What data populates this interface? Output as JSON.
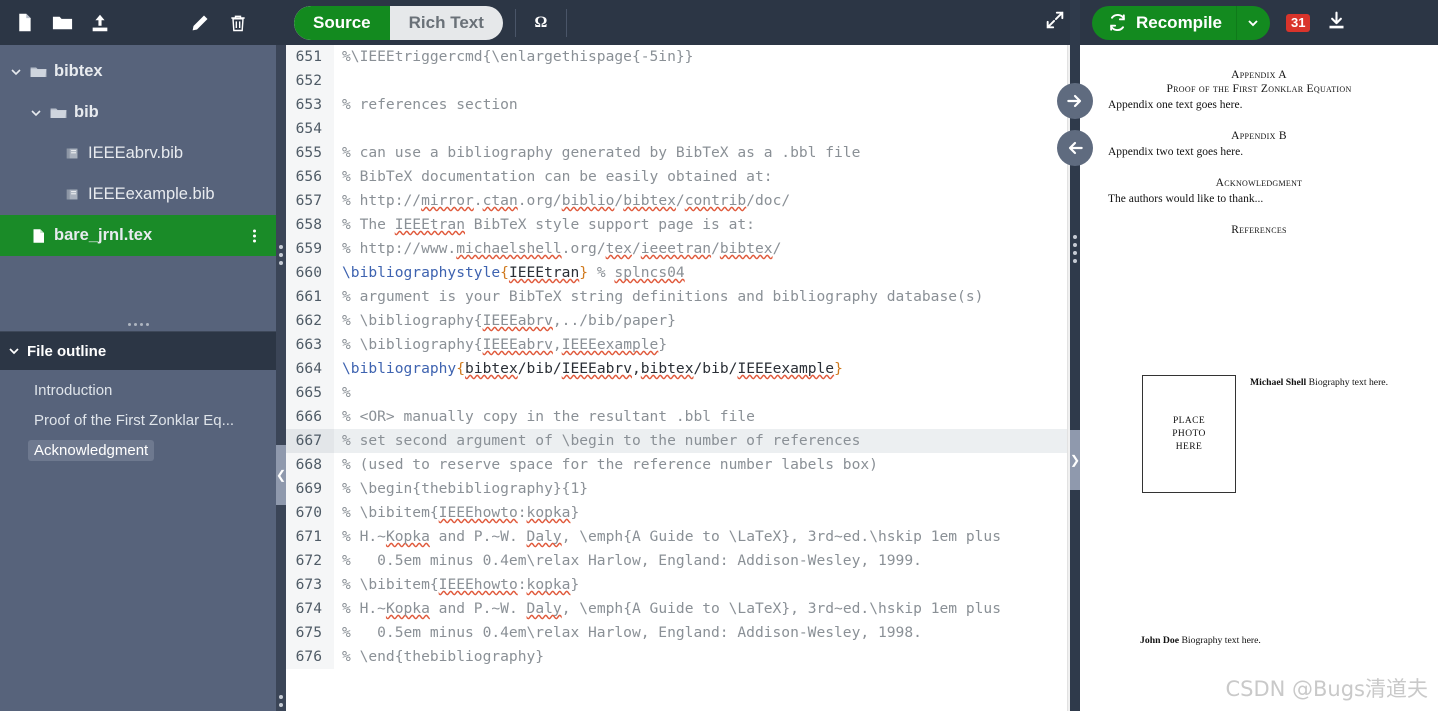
{
  "file_toolbar": {
    "icons": [
      {
        "name": "new-file-icon",
        "label": "New file"
      },
      {
        "name": "new-folder-icon",
        "label": "New folder"
      },
      {
        "name": "upload-icon",
        "label": "Upload"
      },
      {
        "name": "rename-pencil-icon",
        "label": "Rename"
      },
      {
        "name": "delete-trash-icon",
        "label": "Delete"
      }
    ]
  },
  "file_tree": {
    "items": [
      {
        "label": "bibtex",
        "type": "folder",
        "depth": 0,
        "expanded": true,
        "selected": false
      },
      {
        "label": "bib",
        "type": "folder",
        "depth": 1,
        "expanded": true,
        "selected": false
      },
      {
        "label": "IEEEabrv.bib",
        "type": "bib",
        "depth": 2,
        "selected": false
      },
      {
        "label": "IEEEexample.bib",
        "type": "bib",
        "depth": 2,
        "selected": false
      },
      {
        "label": "bare_jrnl.tex",
        "type": "tex",
        "depth": 0,
        "selected": true
      }
    ]
  },
  "outline": {
    "title": "File outline",
    "expanded": true,
    "items": [
      {
        "label": "Introduction",
        "active": false
      },
      {
        "label": "Proof of the First Zonklar Eq...",
        "active": false
      },
      {
        "label": "Acknowledgment",
        "active": true
      }
    ]
  },
  "editor_toolbar": {
    "mode_source": "Source",
    "mode_rich_text": "Rich Text",
    "symbol_button": "Ω",
    "expand_label": "Expand editor"
  },
  "pdf_toolbar": {
    "recompile_label": "Recompile",
    "log_badge_count": "31",
    "download_label": "Download PDF"
  },
  "colors": {
    "accent_green": "#138a1f",
    "toolbar_dark": "#2c3645",
    "sidebar": "#57637b",
    "badge_red": "#d9342b",
    "spell_underline": "#e05a3c",
    "command_blue": "#3e63b0",
    "brace_orange": "#d07a1e",
    "comment_gray": "#8a9096"
  },
  "code": {
    "first_line": 651,
    "active_line": 667,
    "lines": [
      {
        "n": 651,
        "segments": [
          {
            "t": "%\\IEEEtriggercmd{\\enlargethispage{-5in}}",
            "c": "cmt"
          }
        ]
      },
      {
        "n": 652,
        "segments": [
          {
            "t": "",
            "c": "cmt"
          }
        ]
      },
      {
        "n": 653,
        "segments": [
          {
            "t": "% references section",
            "c": "cmt"
          }
        ]
      },
      {
        "n": 654,
        "segments": [
          {
            "t": "",
            "c": "cmt"
          }
        ]
      },
      {
        "n": 655,
        "segments": [
          {
            "t": "% can use a bibliography generated by BibTeX as a .bbl file",
            "c": "cmt"
          }
        ]
      },
      {
        "n": 656,
        "segments": [
          {
            "t": "% BibTeX documentation can be easily obtained at:",
            "c": "cmt"
          }
        ]
      },
      {
        "n": 657,
        "segments": [
          {
            "t": "% http://",
            "c": "cmt"
          },
          {
            "t": "mirror",
            "c": "cmt sq"
          },
          {
            "t": ".",
            "c": "cmt"
          },
          {
            "t": "ctan",
            "c": "cmt sq"
          },
          {
            "t": ".org/",
            "c": "cmt"
          },
          {
            "t": "biblio",
            "c": "cmt sq"
          },
          {
            "t": "/",
            "c": "cmt"
          },
          {
            "t": "bibtex",
            "c": "cmt sq"
          },
          {
            "t": "/",
            "c": "cmt"
          },
          {
            "t": "contrib",
            "c": "cmt sq"
          },
          {
            "t": "/doc/",
            "c": "cmt"
          }
        ]
      },
      {
        "n": 658,
        "segments": [
          {
            "t": "% The ",
            "c": "cmt"
          },
          {
            "t": "IEEEtran",
            "c": "cmt sq"
          },
          {
            "t": " BibTeX style support page is at:",
            "c": "cmt"
          }
        ]
      },
      {
        "n": 659,
        "segments": [
          {
            "t": "% http://www.",
            "c": "cmt"
          },
          {
            "t": "michaelshell",
            "c": "cmt sq"
          },
          {
            "t": ".org/",
            "c": "cmt"
          },
          {
            "t": "tex",
            "c": "cmt sq"
          },
          {
            "t": "/",
            "c": "cmt"
          },
          {
            "t": "ieeetran",
            "c": "cmt sq"
          },
          {
            "t": "/",
            "c": "cmt"
          },
          {
            "t": "bibtex",
            "c": "cmt sq"
          },
          {
            "t": "/",
            "c": "cmt"
          }
        ]
      },
      {
        "n": 660,
        "segments": [
          {
            "t": "\\bibliographystyle",
            "c": "cmd"
          },
          {
            "t": "{",
            "c": "brc"
          },
          {
            "t": "IEEEtran",
            "c": "arg sq"
          },
          {
            "t": "}",
            "c": "brc"
          },
          {
            "t": " % ",
            "c": "cmt"
          },
          {
            "t": "splncs04",
            "c": "cmt sq"
          }
        ]
      },
      {
        "n": 661,
        "segments": [
          {
            "t": "% argument is your BibTeX string definitions and bibliography database(s)",
            "c": "cmt"
          }
        ]
      },
      {
        "n": 662,
        "segments": [
          {
            "t": "% \\bibliography{",
            "c": "cmt"
          },
          {
            "t": "IEEEabrv",
            "c": "cmt sq"
          },
          {
            "t": ",../bib/paper}",
            "c": "cmt"
          }
        ]
      },
      {
        "n": 663,
        "segments": [
          {
            "t": "% \\bibliography{",
            "c": "cmt"
          },
          {
            "t": "IEEEabrv",
            "c": "cmt sq"
          },
          {
            "t": ",",
            "c": "cmt"
          },
          {
            "t": "IEEEexample",
            "c": "cmt sq"
          },
          {
            "t": "}",
            "c": "cmt"
          }
        ]
      },
      {
        "n": 664,
        "segments": [
          {
            "t": "\\bibliography",
            "c": "cmd"
          },
          {
            "t": "{",
            "c": "brc"
          },
          {
            "t": "bibtex",
            "c": "arg sq"
          },
          {
            "t": "/bib/",
            "c": "arg"
          },
          {
            "t": "IEEEabrv",
            "c": "arg sq"
          },
          {
            "t": ",",
            "c": "arg"
          },
          {
            "t": "bibtex",
            "c": "arg sq"
          },
          {
            "t": "/bib/",
            "c": "arg"
          },
          {
            "t": "IEEEexample",
            "c": "arg sq"
          },
          {
            "t": "}",
            "c": "brc"
          }
        ]
      },
      {
        "n": 665,
        "segments": [
          {
            "t": "%",
            "c": "cmt"
          }
        ]
      },
      {
        "n": 666,
        "segments": [
          {
            "t": "% <OR> manually copy in the resultant .bbl file",
            "c": "cmt"
          }
        ]
      },
      {
        "n": 667,
        "segments": [
          {
            "t": "% set second argument of \\begin to the number of references",
            "c": "cmt"
          }
        ]
      },
      {
        "n": 668,
        "segments": [
          {
            "t": "% (used to reserve space for the reference number labels box)",
            "c": "cmt"
          }
        ]
      },
      {
        "n": 669,
        "segments": [
          {
            "t": "% \\begin{thebibliography}{1}",
            "c": "cmt"
          }
        ]
      },
      {
        "n": 670,
        "segments": [
          {
            "t": "% \\bibitem{",
            "c": "cmt"
          },
          {
            "t": "IEEEhowto",
            "c": "cmt sq"
          },
          {
            "t": ":",
            "c": "cmt"
          },
          {
            "t": "kopka",
            "c": "cmt sq"
          },
          {
            "t": "}",
            "c": "cmt"
          }
        ]
      },
      {
        "n": 671,
        "segments": [
          {
            "t": "% H.~",
            "c": "cmt"
          },
          {
            "t": "Kopka",
            "c": "cmt sq"
          },
          {
            "t": " and P.~W. ",
            "c": "cmt"
          },
          {
            "t": "Daly",
            "c": "cmt sq"
          },
          {
            "t": ", \\emph{A Guide to \\LaTeX}, 3rd~ed.\\hskip 1em plus",
            "c": "cmt"
          }
        ]
      },
      {
        "n": 672,
        "segments": [
          {
            "t": "%   0.5em minus 0.4em\\relax Harlow, England: Addison-Wesley, 1999.",
            "c": "cmt"
          }
        ]
      },
      {
        "n": 673,
        "segments": [
          {
            "t": "% \\bibitem{",
            "c": "cmt"
          },
          {
            "t": "IEEEhowto",
            "c": "cmt sq"
          },
          {
            "t": ":",
            "c": "cmt"
          },
          {
            "t": "kopka",
            "c": "cmt sq"
          },
          {
            "t": "}",
            "c": "cmt"
          }
        ]
      },
      {
        "n": 674,
        "segments": [
          {
            "t": "% H.~",
            "c": "cmt"
          },
          {
            "t": "Kopka",
            "c": "cmt sq"
          },
          {
            "t": " and P.~W. ",
            "c": "cmt"
          },
          {
            "t": "Daly",
            "c": "cmt sq"
          },
          {
            "t": ", \\emph{A Guide to \\LaTeX}, 3rd~ed.\\hskip 1em plus",
            "c": "cmt"
          }
        ]
      },
      {
        "n": 675,
        "segments": [
          {
            "t": "%   0.5em minus 0.4em\\relax Harlow, England: Addison-Wesley, 1998.",
            "c": "cmt"
          }
        ]
      },
      {
        "n": 676,
        "segments": [
          {
            "t": "% \\end{thebibliography}",
            "c": "cmt"
          }
        ]
      }
    ]
  },
  "pdf_preview": {
    "appendix_a_title": "Appendix A",
    "appendix_a_subtitle": "Proof of the First Zonklar Equation",
    "appendix_a_body": "Appendix one text goes here.",
    "appendix_b_title": "Appendix B",
    "appendix_b_body": "Appendix two text goes here.",
    "acknowledgment_title": "Acknowledgment",
    "acknowledgment_body": "The authors would like to thank...",
    "references_title": "References",
    "photo_placeholder": "PLACE\nPHOTO\nHERE",
    "bio1_name": "Michael Shell",
    "bio1_text": " Biography text here.",
    "bio2_name": "John Doe",
    "bio2_text": " Biography text here."
  },
  "watermark": {
    "text": "CSDN @Bugs清道夫"
  },
  "sync_controls": {
    "to_pdf_label": "Go to code location in PDF",
    "to_code_label": "Go to PDF location in code"
  }
}
